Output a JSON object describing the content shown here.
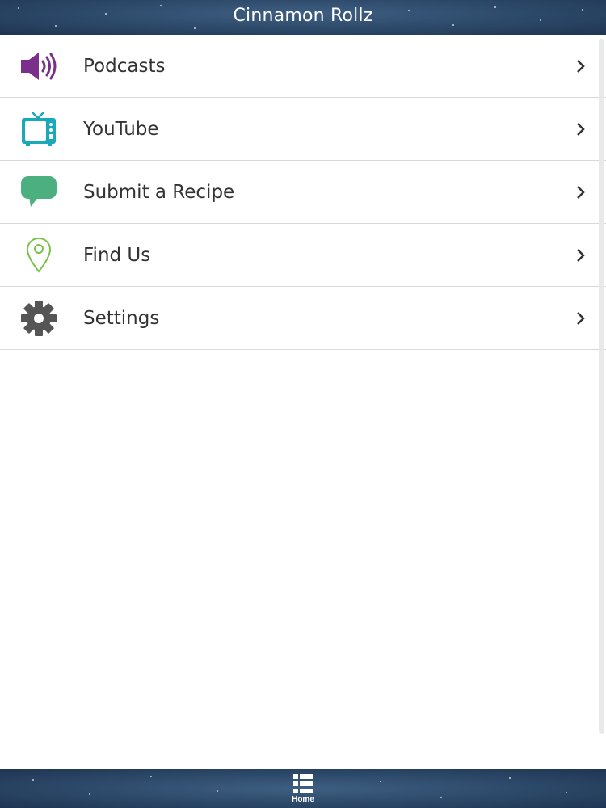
{
  "header": {
    "title": "Cinnamon Rollz"
  },
  "menu": {
    "items": [
      {
        "label": "Podcasts",
        "icon": "speaker-icon",
        "color": "#7a2f8a"
      },
      {
        "label": "YouTube",
        "icon": "tv-icon",
        "color": "#1aa9b8"
      },
      {
        "label": "Submit a Recipe",
        "icon": "chat-bubble-icon",
        "color": "#4caf80"
      },
      {
        "label": "Find Us",
        "icon": "map-pin-icon",
        "color": "#7cc04a"
      },
      {
        "label": "Settings",
        "icon": "gear-icon",
        "color": "#555555"
      }
    ]
  },
  "tabbar": {
    "home_label": "Home"
  },
  "colors": {
    "bar_background": "#2c4868",
    "row_divider": "#d9d9d9",
    "label_text": "#333333"
  }
}
